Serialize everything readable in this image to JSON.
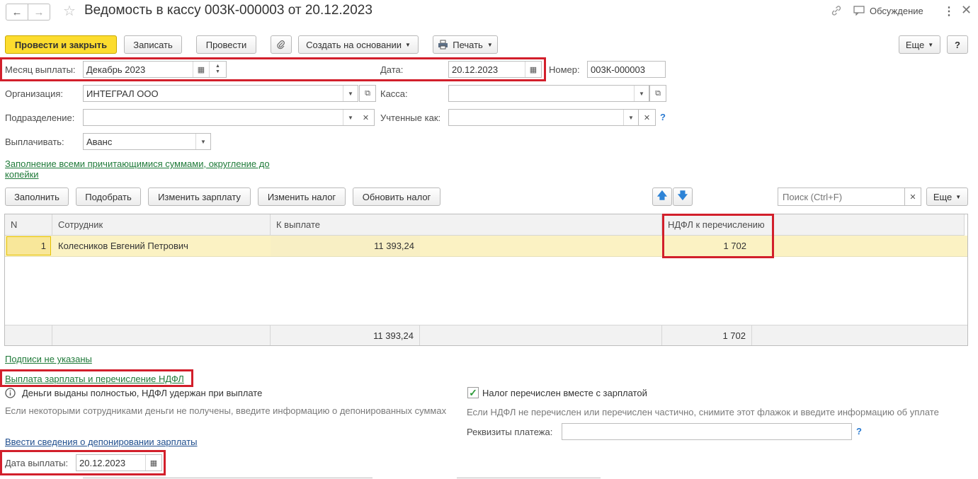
{
  "window": {
    "title": "Ведомость в кассу 003К-000003 от 20.12.2023",
    "discussion_label": "Обсуждение"
  },
  "toolbar": {
    "post_close_label": "Провести и закрыть",
    "save_label": "Записать",
    "post_label": "Провести",
    "create_based_label": "Создать на основании",
    "print_label": "Печать",
    "more_label": "Еще",
    "help_label": "?"
  },
  "form": {
    "month_label": "Месяц выплаты:",
    "month_value": "Декабрь 2023",
    "date_label": "Дата:",
    "date_value": "20.12.2023",
    "number_label": "Номер:",
    "number_value": "003К-000003",
    "org_label": "Организация:",
    "org_value": "ИНТЕГРАЛ ООО",
    "cash_label": "Касса:",
    "cash_value": "",
    "division_label": "Подразделение:",
    "division_value": "",
    "accounted_label": "Учтенные как:",
    "accounted_value": "",
    "pay_label": "Выплачивать:",
    "pay_value": "Аванс",
    "fill_link_line1": "Заполнение всеми причитающимися суммами, округление до",
    "fill_link_line2": "копейки"
  },
  "table_toolbar": {
    "fill_label": "Заполнить",
    "pick_label": "Подобрать",
    "change_salary_label": "Изменить зарплату",
    "change_tax_label": "Изменить налог",
    "update_tax_label": "Обновить налог",
    "search_placeholder": "Поиск (Ctrl+F)",
    "more_label": "Еще"
  },
  "table": {
    "columns": [
      "N",
      "Сотрудник",
      "К выплате",
      "НДФЛ к перечислению"
    ],
    "rows": [
      {
        "n": "1",
        "employee": "Колесников Евгений Петрович",
        "to_pay": "11 393,24",
        "ndfl": "1 702"
      }
    ],
    "totals": {
      "to_pay": "11 393,24",
      "ndfl": "1 702"
    }
  },
  "bottom": {
    "signatures_link": "Подписи не указаны",
    "payment_link": "Выплата зарплаты и перечисление НДФЛ",
    "money_status": "Деньги выданы полностью, НДФЛ удержан при выплате",
    "money_hint": "Если некоторыми сотрудниками деньги не получены, введите информацию о депонированных суммах",
    "deposit_link": "Ввести сведения о депонировании зарплаты",
    "pay_date_label": "Дата выплаты:",
    "pay_date_value": "20.12.2023",
    "tax_checkbox_label": "Налог перечислен вместе с зарплатой",
    "tax_checked": true,
    "tax_hint": "Если НДФЛ не перечислен или перечислен частично, снимите этот флажок и введите информацию об уплате",
    "payment_details_label": "Реквизиты платежа:",
    "payment_details_value": ""
  },
  "colors": {
    "accent_yellow": "#fcdc2e",
    "highlight_red": "#d21f2b",
    "link_green": "#1f7a39",
    "row_selected": "#fbf2c3"
  }
}
